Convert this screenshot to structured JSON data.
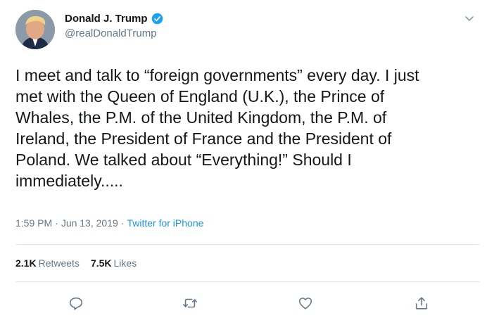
{
  "author": {
    "display_name": "Donald J. Trump",
    "handle": "@realDonaldTrump",
    "verified": true,
    "avatar_icon": "profile-photo"
  },
  "tweet": {
    "text": "I meet and talk to “foreign governments” every day. I just\nmet with the Queen of England (U.K.), the Prince of\nWhales, the P.M. of the United Kingdom, the P.M. of\nIreland, the President of France and the President of\nPoland. We talked about “Everything!” Should I\nimmediately.....",
    "time": "1:59 PM",
    "separator": "·",
    "date": "Jun 13, 2019",
    "source": "Twitter for iPhone"
  },
  "stats": {
    "retweets_count": "2.1K",
    "retweets_label": "Retweets",
    "likes_count": "7.5K",
    "likes_label": "Likes"
  },
  "actions": [
    "reply-icon",
    "retweet-icon",
    "like-icon",
    "share-icon"
  ],
  "colors": {
    "text": "#14171a",
    "secondary": "#657786",
    "link": "#1b95e0",
    "verified": "#1da1f2",
    "divider": "#e1e8ed"
  }
}
